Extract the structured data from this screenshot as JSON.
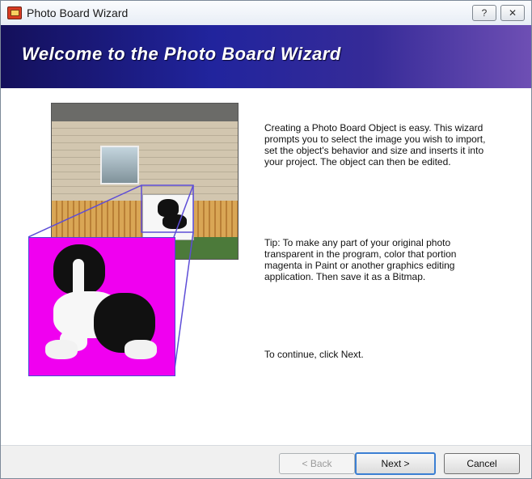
{
  "window": {
    "title": "Photo Board Wizard",
    "help_button": "?",
    "close_button": "✕"
  },
  "header": {
    "title": "Welcome to the Photo Board Wizard"
  },
  "content": {
    "intro": "Creating a Photo Board Object is easy. This wizard prompts you to select the image you wish to import, set the object's behavior and size and inserts it into your project. The object can then be edited.",
    "tip": "Tip: To make any part of your original photo transparent in the program, color that portion magenta in Paint or another graphics editing application. Then save it as a Bitmap.",
    "continue_text": "To continue, click Next."
  },
  "buttons": {
    "back": "< Back",
    "next": "Next >",
    "cancel": "Cancel"
  },
  "colors": {
    "header_start": "#14105b",
    "header_end": "#6e4fb4",
    "magenta": "#f000f0"
  }
}
